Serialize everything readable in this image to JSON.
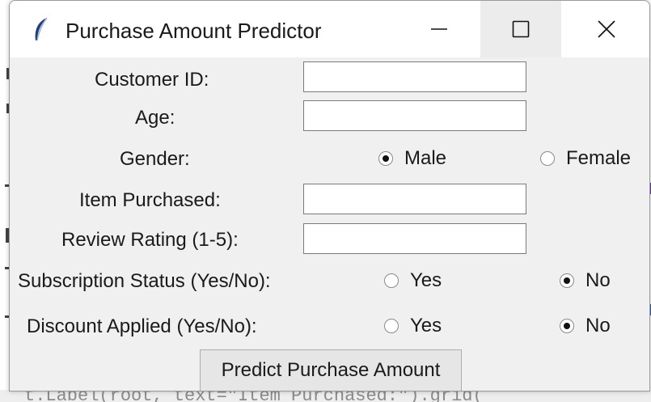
{
  "window": {
    "title": "Purchase Amount Predictor",
    "minimize_icon": "minimize-icon",
    "maximize_icon": "maximize-icon",
    "close_icon": "close-icon",
    "app_icon": "feather-icon"
  },
  "form": {
    "customer_id": {
      "label": "Customer ID:",
      "value": ""
    },
    "age": {
      "label": "Age:",
      "value": ""
    },
    "gender": {
      "label": "Gender:",
      "options": [
        {
          "label": "Male",
          "selected": true
        },
        {
          "label": "Female",
          "selected": false
        }
      ]
    },
    "item_purchased": {
      "label": "Item Purchased:",
      "value": ""
    },
    "review_rating": {
      "label": "Review Rating (1-5):",
      "value": ""
    },
    "subscription_status": {
      "label": "Subscription Status (Yes/No):",
      "options": [
        {
          "label": "Yes",
          "selected": false
        },
        {
          "label": "No",
          "selected": true
        }
      ]
    },
    "discount_applied": {
      "label": "Discount Applied (Yes/No):",
      "options": [
        {
          "label": "Yes",
          "selected": false
        },
        {
          "label": "No",
          "selected": true
        }
      ]
    },
    "predict_button": "Predict Purchase Amount"
  },
  "background": {
    "ghost_text": "t.Label(root, text=\"Item Purchased:\").grid("
  }
}
